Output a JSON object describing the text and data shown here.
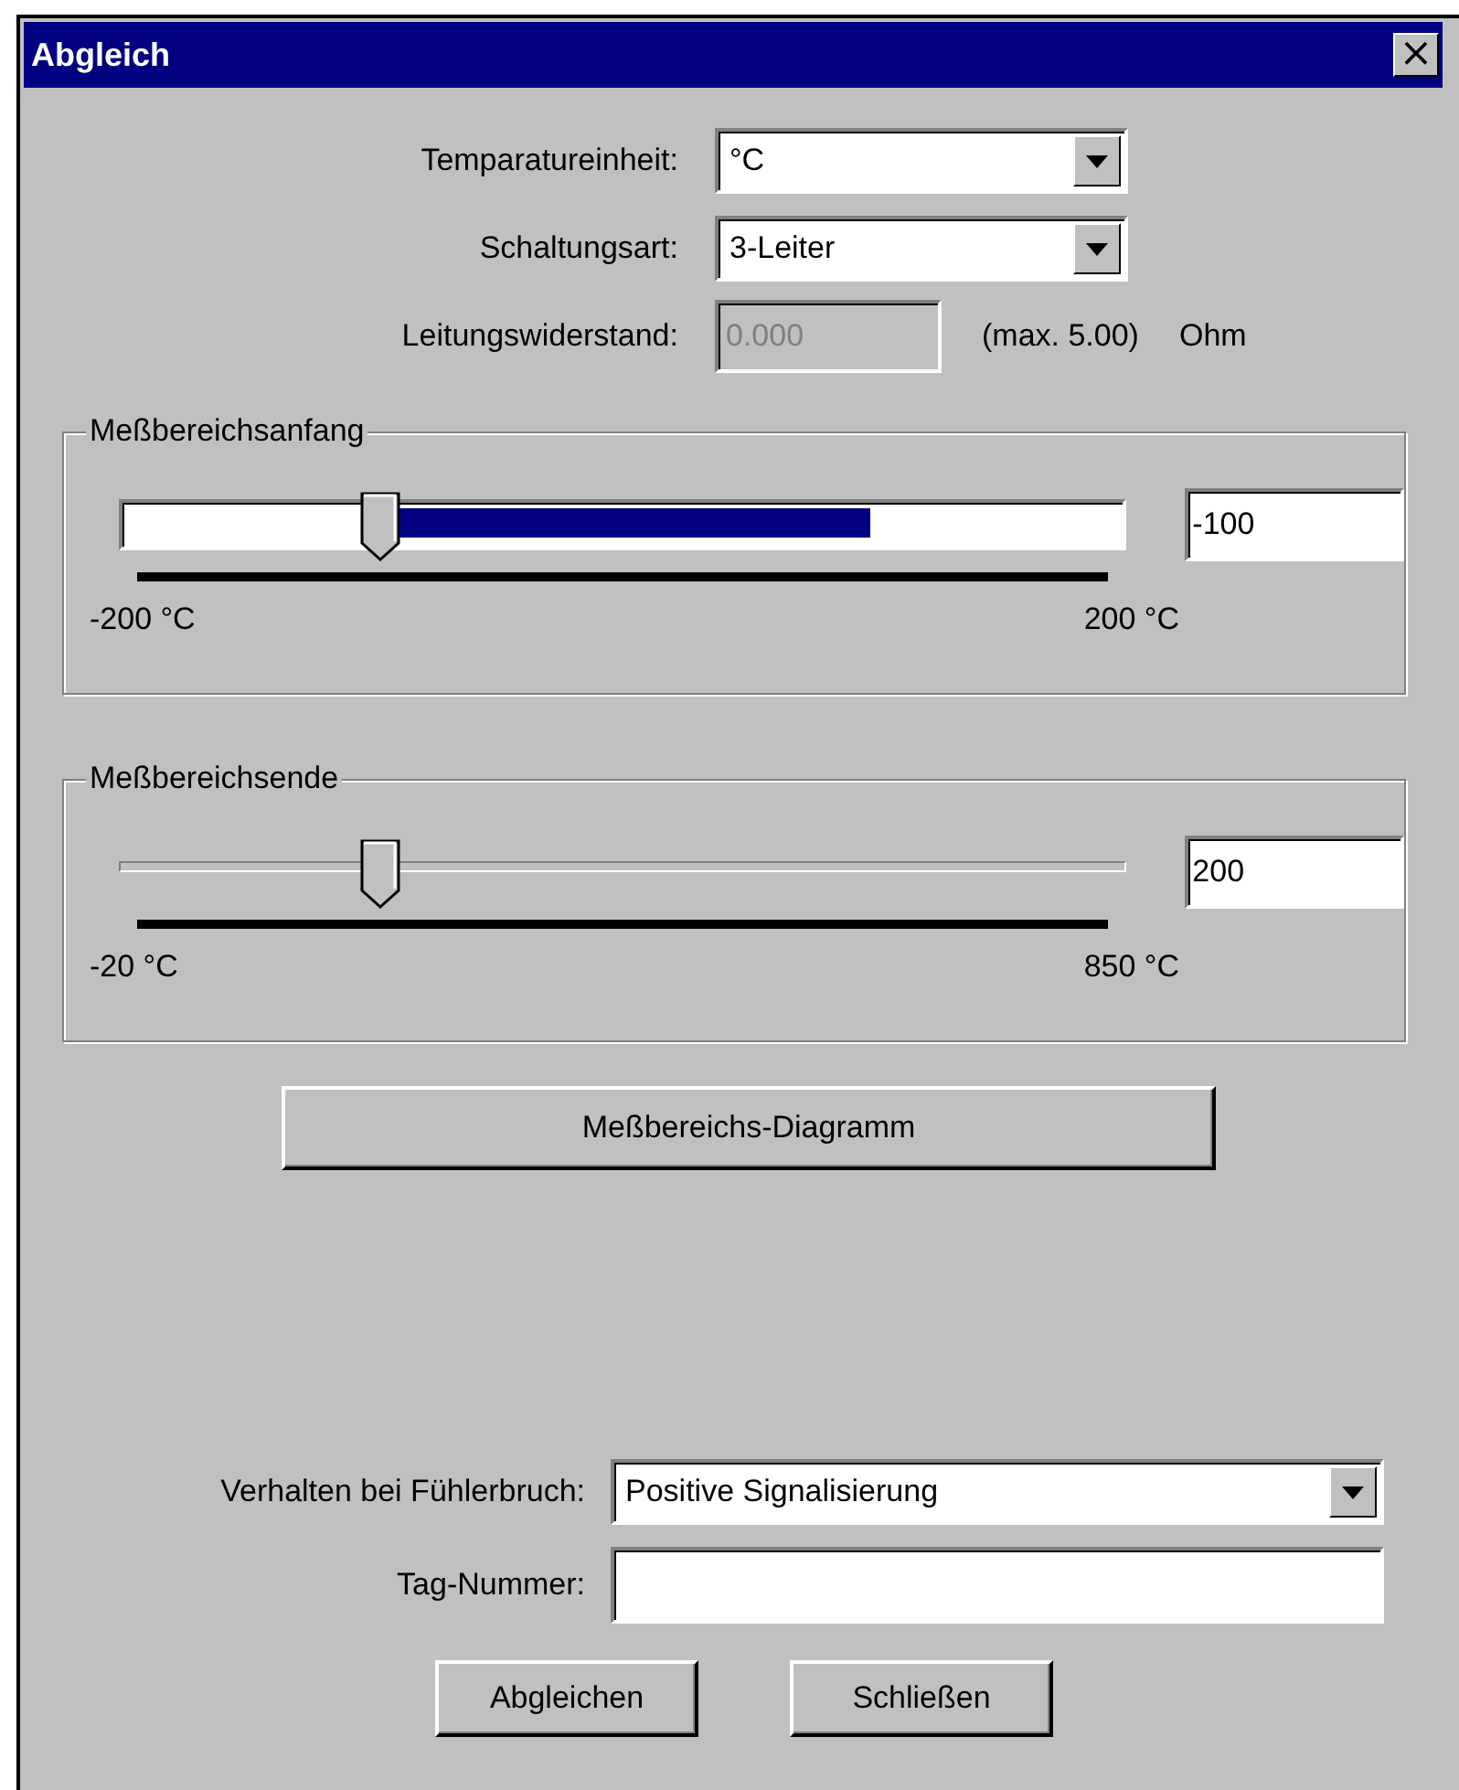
{
  "window": {
    "title": "Abgleich",
    "close": "×"
  },
  "settings": [
    {
      "kind": "combo",
      "label": "Temparatureinheit:",
      "value": "°C",
      "disabled": false
    },
    {
      "kind": "combo",
      "label": "Schaltungsart:",
      "value": "3-Leiter",
      "disabled": false
    },
    {
      "kind": "text",
      "label": "Leitungswiderstand:",
      "value": "0.000",
      "disabled": true,
      "hint": "(max. 5.00)",
      "unit": "Ohm"
    }
  ],
  "ranges": [
    {
      "title": "Meßbereichsanfang",
      "kind": "selection",
      "level": 0.26,
      "selection": {
        "level": 0.47
      },
      "value": "-100",
      "min_label": "-200 °C",
      "max_label": "200 °C"
    },
    {
      "title": "Meßbereichsende",
      "kind": "plain",
      "level": 0.26,
      "value": "200",
      "min_label": "-20 °C",
      "max_label": "850 °C"
    }
  ],
  "diagram_button": "Meßbereichs-Diagramm",
  "sensor_break": {
    "label": "Verhalten bei Fühlerbruch:",
    "value": "Positive Signalisierung"
  },
  "tag_number": {
    "label": "Tag-Nummer:"
  },
  "buttons": [
    "Abgleichen",
    "Schließen"
  ]
}
